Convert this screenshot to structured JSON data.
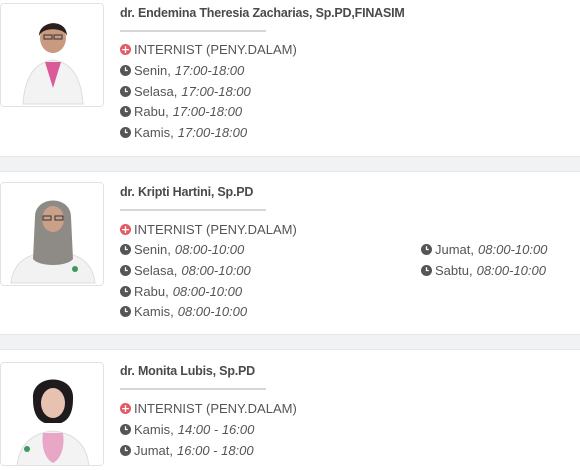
{
  "doctors": [
    {
      "name": "dr. Endemina Theresia Zacharias, Sp.PD,FINASIM",
      "specialty": "INTERNIST (PENY.DALAM)",
      "schedule_left": [
        {
          "day": "Senin,",
          "time": "17:00-18:00"
        },
        {
          "day": "Selasa,",
          "time": "17:00-18:00"
        },
        {
          "day": "Rabu,",
          "time": "17:00-18:00"
        },
        {
          "day": "Kamis,",
          "time": "17:00-18:00"
        }
      ]
    },
    {
      "name": "dr. Kripti Hartini, Sp.PD",
      "specialty": "INTERNIST (PENY.DALAM)",
      "schedule_left": [
        {
          "day": "Senin,",
          "time": "08:00-10:00"
        },
        {
          "day": "Selasa,",
          "time": "08:00-10:00"
        },
        {
          "day": "Rabu,",
          "time": "08:00-10:00"
        },
        {
          "day": "Kamis,",
          "time": "08:00-10:00"
        }
      ],
      "schedule_right": [
        {
          "day": "Jumat,",
          "time": "08:00-10:00"
        },
        {
          "day": "Sabtu,",
          "time": "08:00-10:00"
        }
      ]
    },
    {
      "name": "dr. Monita Lubis, Sp.PD",
      "specialty": "INTERNIST (PENY.DALAM)",
      "schedule_left": [
        {
          "day": "Kamis,",
          "time": "14:00 - 16:00"
        },
        {
          "day": "Jumat,",
          "time": "16:00 - 18:00"
        }
      ]
    }
  ],
  "icons": {
    "specialty": "plus-circle-icon",
    "schedule": "clock-icon"
  },
  "colors": {
    "specialty_icon": "#e35a63",
    "clock_icon": "#555555",
    "separator": "#f1f2f4"
  }
}
